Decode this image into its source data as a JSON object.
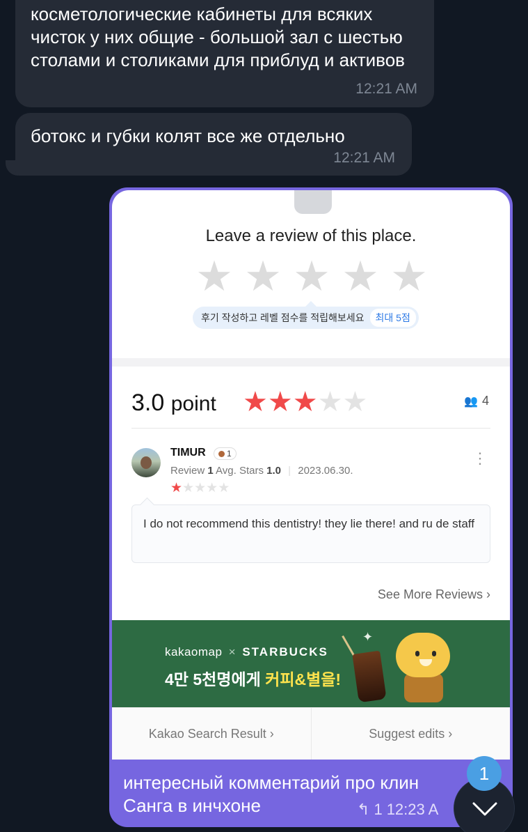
{
  "messages": [
    {
      "text": "косметологические кабинеты для всяких чисток у них общие - большой зал с шестью столами и столиками для приблуд и активов",
      "time": "12:21 AM"
    },
    {
      "text": "ботокс и губки колят все же отдельно",
      "time": "12:21 AM"
    }
  ],
  "outgoing": {
    "caption_line1": "интересный комментарий про клин",
    "caption_line2": "Санга в инчхоне",
    "reply_count": "1",
    "time": "12:23 A"
  },
  "screenshot": {
    "review_prompt": "Leave a review of this place.",
    "promo_text": "후기 작성하고 레벨 점수를 적립해보세요",
    "promo_badge": "최대 5점",
    "rating_number": "3.0",
    "rating_unit": "point",
    "rating_value": 3,
    "rating_max": 5,
    "reviewer_count": "4",
    "review": {
      "author": "TIMUR",
      "level": "1",
      "review_label": "Review",
      "review_count": "1",
      "avg_label": "Avg. Stars",
      "avg_value": "1.0",
      "date": "2023.06.30.",
      "stars": 1,
      "text": "I do not recommend this dentistry! they lie there! and ru de staff"
    },
    "see_more": "See More Reviews",
    "banner": {
      "brand_kakao": "kakaomap",
      "brand_x": "×",
      "brand_starbucks": "STARBUCKS",
      "headline_main": "4만 5천명에게 ",
      "headline_highlight": "커피&별을!"
    },
    "links": {
      "search": "Kakao Search Result",
      "edits": "Suggest edits"
    }
  },
  "unread_count": "1",
  "icons": {
    "scroll_down": "chevron-down-icon",
    "reply": "reply-arrow-icon",
    "people": "people-icon",
    "more": "kebab-menu-icon"
  },
  "colors": {
    "chat_bg": "#111823",
    "incoming_bubble": "#252b36",
    "outgoing_bubble": "#7666e0",
    "star_active": "#f04a4a",
    "badge_blue": "#4a9fe3",
    "banner_green": "#2d6b43"
  }
}
